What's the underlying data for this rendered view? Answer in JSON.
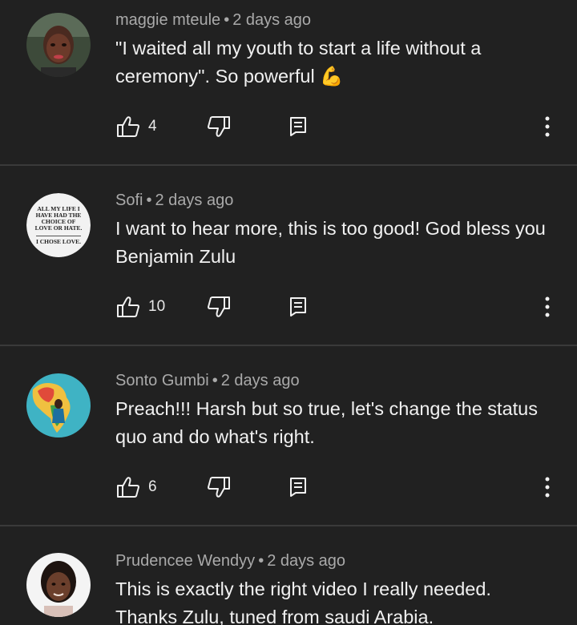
{
  "comments": [
    {
      "author": "maggie mteule",
      "separator": "•",
      "time": "2 days ago",
      "text": "\"I waited all my youth to start a life without a ceremony\". So powerful 💪",
      "likes": "4",
      "avatar_icon": "profile-photo"
    },
    {
      "author": "Sofi",
      "separator": "•",
      "time": "2 days ago",
      "text": "I want to hear more, this is too good! God bless you Benjamin Zulu",
      "likes": "10",
      "avatar_icon": "quote-image",
      "avatar_text_1": "ALL MY LIFE I HAVE HAD THE CHOICE OF LOVE OR HATE.",
      "avatar_text_2": "I CHOSE LOVE."
    },
    {
      "author": "Sonto Gumbi",
      "separator": "•",
      "time": "2 days ago",
      "text": "Preach!!! Harsh but so true, let's change the status quo and do what's right.",
      "likes": "6",
      "avatar_icon": "africa-map-photo"
    },
    {
      "author": "Prudencee Wendyy",
      "separator": "•",
      "time": "2 days ago",
      "text": "This is exactly the right video I really needed. Thanks Zulu, tuned from saudi Arabia.",
      "avatar_icon": "profile-photo"
    }
  ],
  "colors": {
    "background": "#212121",
    "author_text": "#aaaaaa",
    "body_text": "#f1f1f1",
    "divider": "#3a3a3a"
  }
}
